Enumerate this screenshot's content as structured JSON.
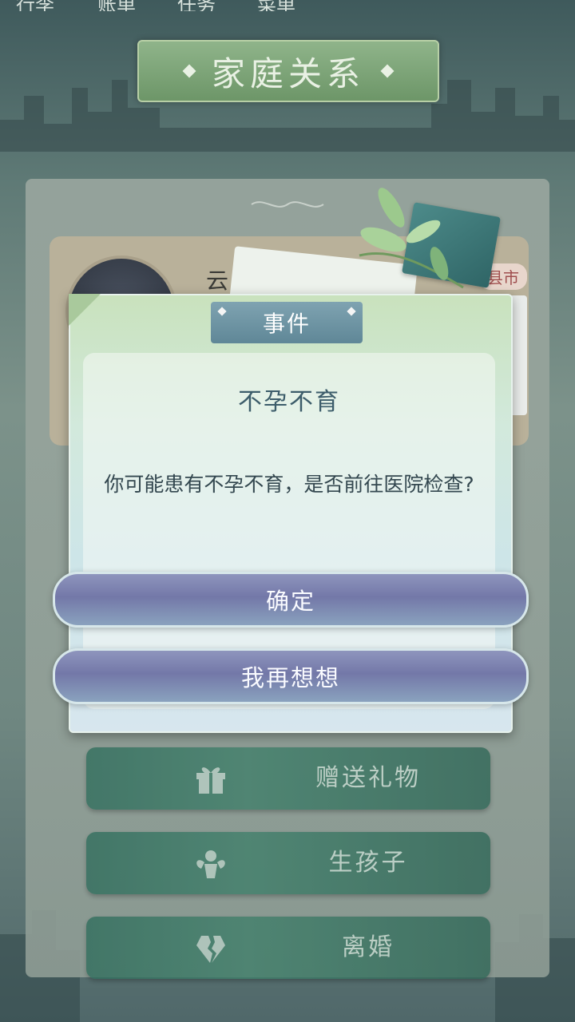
{
  "top_nav": {
    "items": [
      "行李",
      "账单",
      "任务",
      "菜单"
    ]
  },
  "header": {
    "title": "家庭关系"
  },
  "card": {
    "name": "云",
    "city_tag": "县市"
  },
  "dialog": {
    "tab_label": "事件",
    "title": "不孕不育",
    "message": "你可能患有不孕不育，是否前往医院检查?",
    "confirm_label": "确定",
    "rethink_label": "我再想想"
  },
  "actions": {
    "gift_label": "赠送礼物",
    "child_label": "生孩子",
    "divorce_label": "离婚"
  },
  "icons": {
    "gift": "gift-icon",
    "child": "angel-icon",
    "divorce": "broken-heart-icon"
  },
  "colors": {
    "accent_green": "#3f7f6a",
    "button_purple": "#7378a8",
    "title_banner": "#7fa27a"
  }
}
